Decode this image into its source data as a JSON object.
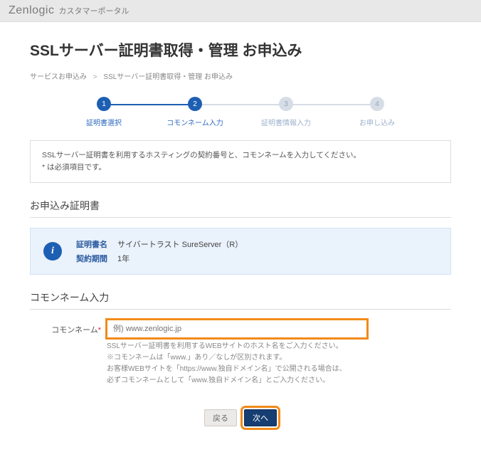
{
  "brand": {
    "name": "Zenlogic",
    "sub": "カスタマーポータル"
  },
  "page": {
    "title": "SSLサーバー証明書取得・管理 お申込み",
    "breadcrumb": {
      "item1": "サービスお申込み",
      "sep": ">",
      "item2": "SSLサーバー証明書取得・管理 お申込み"
    }
  },
  "stepper": {
    "steps": [
      {
        "num": "1",
        "label": "証明書選択"
      },
      {
        "num": "2",
        "label": "コモンネーム入力"
      },
      {
        "num": "3",
        "label": "証明書情報入力"
      },
      {
        "num": "4",
        "label": "お申し込み"
      }
    ]
  },
  "instruction": {
    "line1": "SSLサーバー証明書を利用するホスティングの契約番号と、コモンネームを入力してください。",
    "line2": "* は必須項目です。"
  },
  "sections": {
    "cert_title": "お申込み証明書",
    "cn_title": "コモンネーム入力"
  },
  "cert": {
    "name_label": "証明書名",
    "name_value": "サイバートラスト SureServer（R）",
    "period_label": "契約期間",
    "period_value": "1年"
  },
  "cn": {
    "label": "コモンネーム",
    "required": "*",
    "placeholder": "例) www.zenlogic.jp",
    "help1": "SSLサーバー証明書を利用するWEBサイトのホスト名をご入力ください。",
    "help2": "※コモンネームは「www.」あり／なしが区別されます。",
    "help3": "お客様WEBサイトを「https://www.独自ドメイン名」で公開される場合は、",
    "help4": "必ずコモンネームとして「www.独自ドメイン名」とご入力ください。"
  },
  "buttons": {
    "back": "戻る",
    "next": "次へ"
  }
}
